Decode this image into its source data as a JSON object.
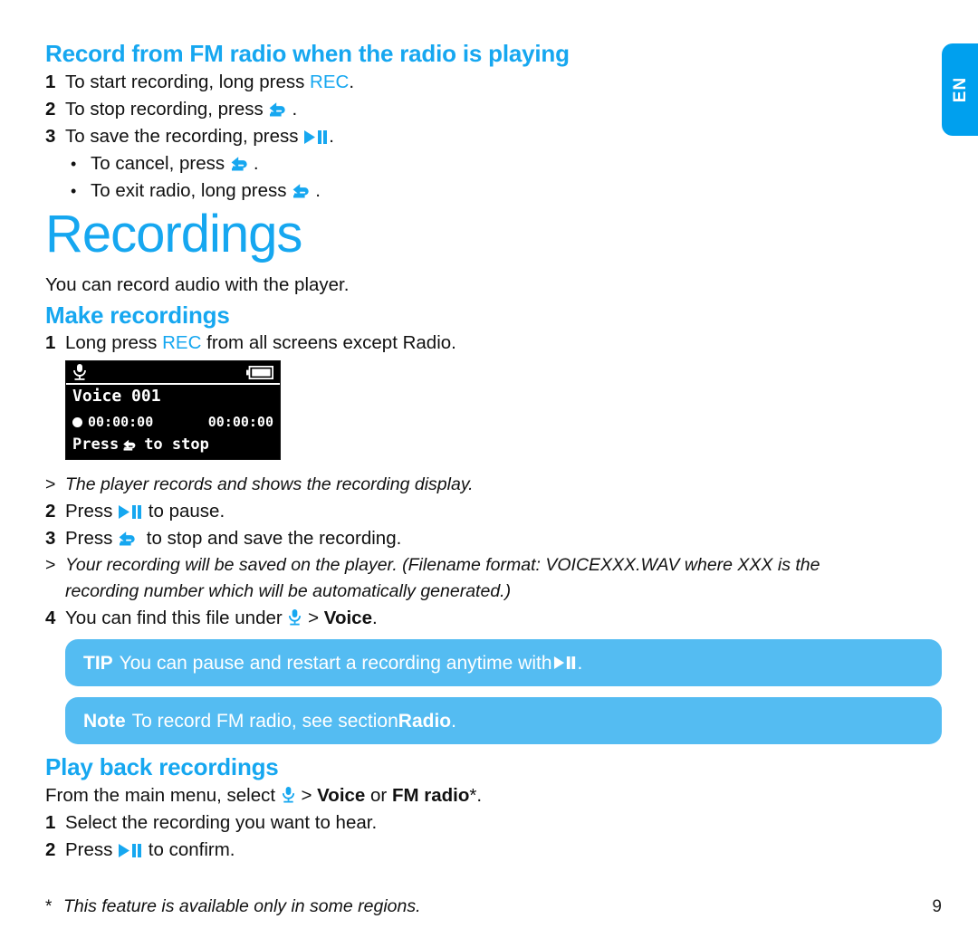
{
  "language_tab": {
    "label": "EN"
  },
  "sections": [
    {
      "heading": "Record from FM radio when the radio is playing",
      "steps": [
        {
          "num": "1",
          "pre": "To start recording, long press ",
          "key": "REC",
          "post": "."
        },
        {
          "num": "2",
          "pre": "To stop recording, press ",
          "icon": "back-arrow-icon",
          "post": "."
        },
        {
          "num": "3",
          "pre": "To save the recording, press ",
          "icon": "play-pause-icon",
          "post": "."
        }
      ],
      "bullets": [
        {
          "bullet": "•",
          "pre": "To cancel, press ",
          "icon": "back-arrow-icon",
          "post": "."
        },
        {
          "bullet": "•",
          "pre": "To exit radio, long press ",
          "icon": "back-arrow-icon",
          "post": "."
        }
      ]
    }
  ],
  "chapter": {
    "title": "Recordings",
    "intro": "You can record audio with the player."
  },
  "make_recordings": {
    "heading": "Make recordings",
    "step1": {
      "num": "1",
      "pre": "Long press ",
      "key": "REC",
      "post": " from all screens except Radio."
    },
    "result1": {
      "marker": ">",
      "text": "The player records and shows the recording display."
    },
    "step2": {
      "num": "2",
      "pre": "Press ",
      "icon": "play-pause-icon",
      "post": " to pause."
    },
    "step3": {
      "num": "3",
      "pre": "Press ",
      "icon": "back-arrow-icon",
      "post": " to stop and save the recording."
    },
    "result2": {
      "marker": ">",
      "line1": "Your recording will be saved on the player. (Filename format: VOICEXXX.WAV where XXX is the",
      "line2": "recording number which will be automatically generated.)"
    },
    "step4": {
      "num": "4",
      "pre": "You can find this file under ",
      "icon": "microphone-icon",
      "mid": " > ",
      "bold": "Voice",
      "post": "."
    }
  },
  "lcd": {
    "status_icons": {
      "left": "microphone-icon",
      "right": "battery-icon"
    },
    "title": "Voice 001",
    "elapsed_time": "00:00:00",
    "total_time": "00:00:00",
    "prompt_pre": "Press",
    "prompt_icon": "back-arrow-icon",
    "prompt_post": "to stop"
  },
  "callouts": [
    {
      "keyword": "TIP",
      "pre": " You can pause and restart a recording anytime with ",
      "icon": "play-pause-icon",
      "post": "."
    },
    {
      "keyword": "Note",
      "pre": " To record FM radio, see section ",
      "bold": "Radio",
      "post": "."
    }
  ],
  "playback": {
    "heading": "Play back recordings",
    "lead_pre": "From the main menu, select ",
    "lead_icon": "microphone-icon",
    "lead_mid": " > ",
    "lead_bold1": "Voice",
    "lead_or": " or ",
    "lead_bold2": "FM radio",
    "lead_post": "*.",
    "step1": {
      "num": "1",
      "text": "Select the recording you want to hear."
    },
    "step2": {
      "num": "2",
      "pre": "Press ",
      "icon": "play-pause-icon",
      "post": " to confirm."
    }
  },
  "footer": {
    "star": "*",
    "text": "This feature is available only in some regions.",
    "page_number": "9"
  },
  "colors": {
    "accent_blue": "#16A7F0",
    "callout_blue": "#54BCF2",
    "tab_blue": "#00A0EE",
    "lcd_background": "#000000",
    "lcd_foreground": "#FFFFFF"
  }
}
